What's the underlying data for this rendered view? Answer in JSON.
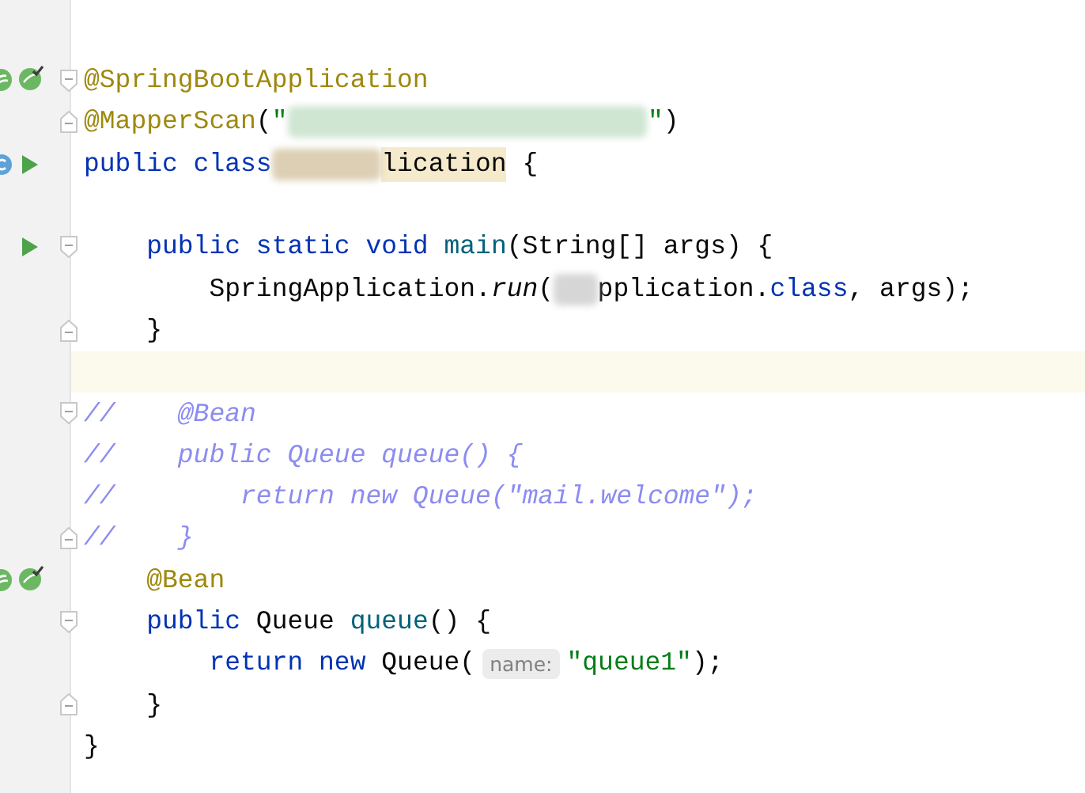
{
  "editor": {
    "lines": [
      {
        "bean_marker": true,
        "fold_open": true,
        "tokens": [
          {
            "kind": "annotation",
            "text": "@SpringBootApplication"
          }
        ]
      },
      {
        "fold_close": true,
        "tokens": [
          {
            "kind": "annotation",
            "text": "@MapperScan"
          },
          {
            "kind": "plain",
            "text": "("
          },
          {
            "kind": "string",
            "text": "\""
          },
          {
            "kind": "redaction",
            "color": "#cfe6d2"
          },
          {
            "kind": "string",
            "text": "\""
          },
          {
            "kind": "plain",
            "text": ")"
          }
        ]
      },
      {
        "class_marker": true,
        "run_marker": true,
        "tokens": [
          {
            "kind": "keyword",
            "text": "public class"
          },
          {
            "kind": "redaction",
            "color": "#dccfb4"
          },
          {
            "kind": "plain",
            "text": "lication",
            "highlight": true
          },
          {
            "kind": "plain",
            "text": " {"
          }
        ]
      },
      {
        "blank_line_before": true,
        "run_marker": true,
        "fold_open": true,
        "tokens": [
          {
            "kind": "keyword",
            "text": "    public static void "
          },
          {
            "kind": "method",
            "text": "main"
          },
          {
            "kind": "plain",
            "text": "(String[] args) {"
          }
        ]
      },
      {
        "tokens": [
          {
            "kind": "plain",
            "text": "        SpringApplication."
          },
          {
            "kind": "call",
            "text": "run"
          },
          {
            "kind": "plain",
            "text": "("
          },
          {
            "kind": "redaction",
            "color": "#d6d6d6"
          },
          {
            "kind": "plain",
            "text": "pplication."
          },
          {
            "kind": "keyword",
            "text": "class"
          },
          {
            "kind": "plain",
            "text": ", args);"
          }
        ]
      },
      {
        "fold_close": true,
        "tokens": [
          {
            "kind": "plain",
            "text": "    }"
          }
        ]
      },
      {
        "current": true
      },
      {
        "fold_open": true,
        "tokens": [
          {
            "kind": "comment",
            "text": "//    @Bean"
          }
        ]
      },
      {
        "tokens": [
          {
            "kind": "comment",
            "text": "//    public Queue queue() {"
          }
        ]
      },
      {
        "tokens": [
          {
            "kind": "comment",
            "text": "//        return new Queue(\"mail.welcome\");"
          }
        ]
      },
      {
        "fold_close": true,
        "tokens": [
          {
            "kind": "comment",
            "text": "//    }"
          }
        ]
      },
      {
        "bean_marker": true,
        "tokens": [
          {
            "kind": "annotation",
            "text": "    @Bean"
          }
        ]
      },
      {
        "fold_open": true,
        "tokens": [
          {
            "kind": "keyword",
            "text": "    public "
          },
          {
            "kind": "plain",
            "text": "Queue "
          },
          {
            "kind": "method",
            "text": "queue"
          },
          {
            "kind": "plain",
            "text": "() {"
          }
        ]
      },
      {
        "tokens": [
          {
            "kind": "keyword",
            "text": "        return new "
          },
          {
            "kind": "plain",
            "text": "Queue("
          },
          {
            "kind": "hint",
            "text": "name:"
          },
          {
            "kind": "string",
            "text": "\"queue1\""
          },
          {
            "kind": "plain",
            "text": ");"
          }
        ]
      },
      {
        "fold_close": true,
        "tokens": [
          {
            "kind": "plain",
            "text": "    }"
          }
        ]
      },
      {
        "tokens": [
          {
            "kind": "plain",
            "text": "}"
          }
        ]
      }
    ]
  }
}
